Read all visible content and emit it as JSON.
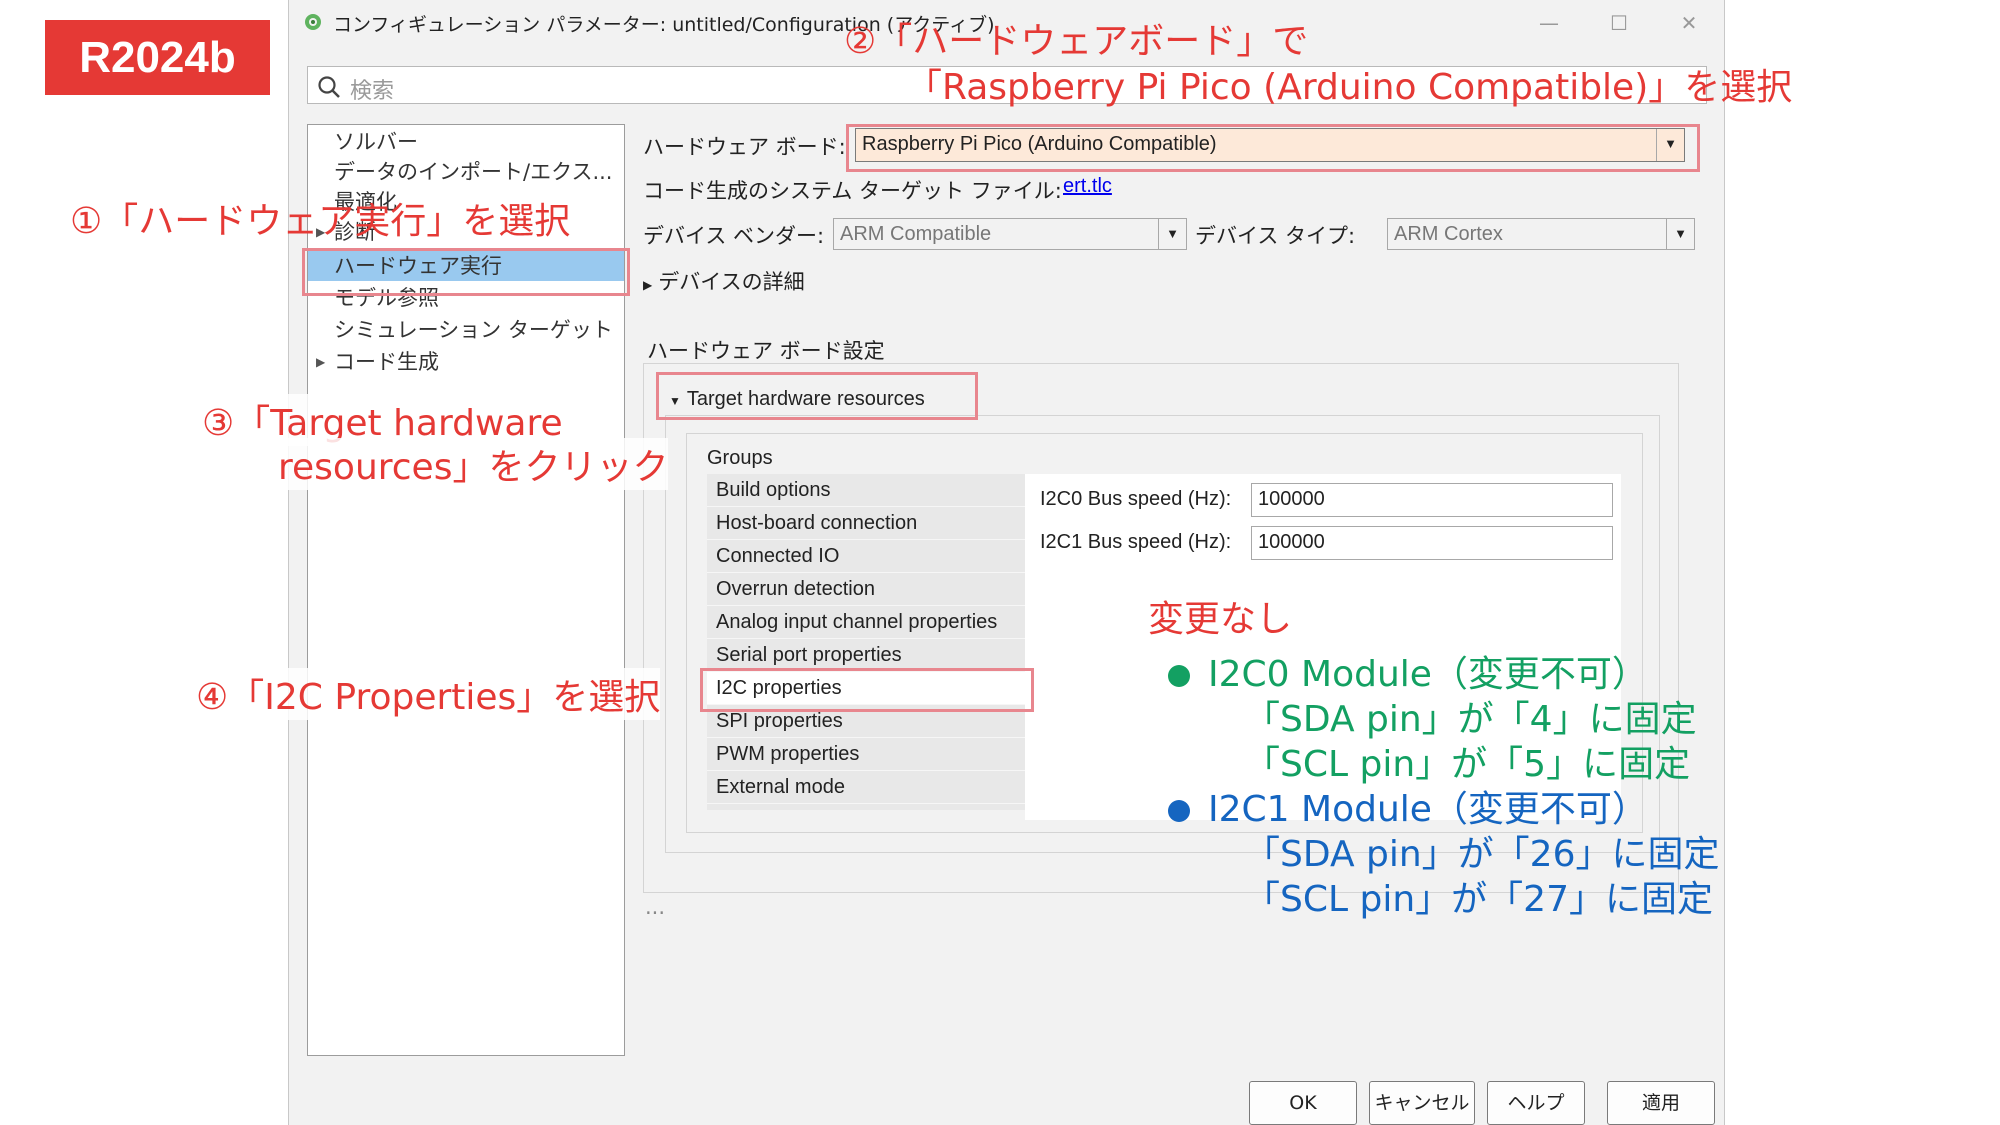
{
  "badge": {
    "version": "R2024b"
  },
  "window": {
    "title": "コンフィギュレーション パラメーター: untitled/Configuration (アクティブ)",
    "minimize": "—",
    "maximize": "☐",
    "close": "✕"
  },
  "search": {
    "placeholder": "検索"
  },
  "nav": {
    "items": [
      {
        "label": "ソルバー",
        "arrow": ""
      },
      {
        "label": "データのインポート/エクス...",
        "arrow": ""
      },
      {
        "label": "最適化",
        "arrow": ""
      },
      {
        "label": "診断",
        "arrow": "▶"
      },
      {
        "label": "ハードウェア実行",
        "arrow": ""
      },
      {
        "label": "モデル参照",
        "arrow": ""
      },
      {
        "label": "シミュレーション ターゲット",
        "arrow": ""
      },
      {
        "label": "コード生成",
        "arrow": "▶"
      }
    ],
    "selected_index": 4
  },
  "hardware": {
    "board_label": "ハードウェア ボード:",
    "board_value": "Raspberry Pi Pico (Arduino Compatible)",
    "target_file_label": "コード生成のシステム ターゲット ファイル:",
    "target_file_link": "ert.tlc",
    "vendor_label": "デバイス ベンダー:",
    "vendor_value": "ARM Compatible",
    "type_label": "デバイス タイプ:",
    "type_value": "ARM Cortex",
    "device_details": "デバイスの詳細",
    "board_settings_heading": "ハードウェア ボード設定",
    "target_resources": "Target hardware resources",
    "groups_heading": "Groups",
    "groups": [
      "Build options",
      "Host-board connection",
      "Connected IO",
      "Overrun detection",
      "Analog input channel properties",
      "Serial port properties",
      "I2C properties",
      "SPI properties",
      "PWM properties",
      "External mode"
    ],
    "selected_group": "I2C properties",
    "i2c0_label": "I2C0 Bus speed (Hz):",
    "i2c0_value": "100000",
    "i2c1_label": "I2C1 Bus speed (Hz):",
    "i2c1_value": "100000",
    "ellipsis": "..."
  },
  "buttons": {
    "ok": "OK",
    "cancel": "キャンセル",
    "help": "ヘルプ",
    "apply": "適用"
  },
  "annotations": {
    "step1": "①「ハードウェア実行」を選択",
    "step2_line1": "②「ハードウェアボード」で",
    "step2_line2": "「Raspberry Pi Pico (Arduino Compatible)」を選択",
    "step3_line1": "③「Target hardware",
    "step3_line2": "resources」をクリック",
    "step4": "④「I2C Properties」を選択",
    "no_change": "変更なし",
    "i2c0_module": "I2C0 Module（変更不可）",
    "i2c0_sda": "「SDA pin」が「4」に固定",
    "i2c0_scl": "「SCL pin」が「5」に固定",
    "i2c1_module": "I2C1 Module（変更不可）",
    "i2c1_sda": "「SDA pin」が「26」に固定",
    "i2c1_scl": "「SCL pin」が「27」に固定"
  },
  "colors": {
    "annotation_red": "#e53935",
    "annotation_green": "#13a062",
    "annotation_blue": "#1565c0",
    "nav_selected": "#99c9ef"
  }
}
